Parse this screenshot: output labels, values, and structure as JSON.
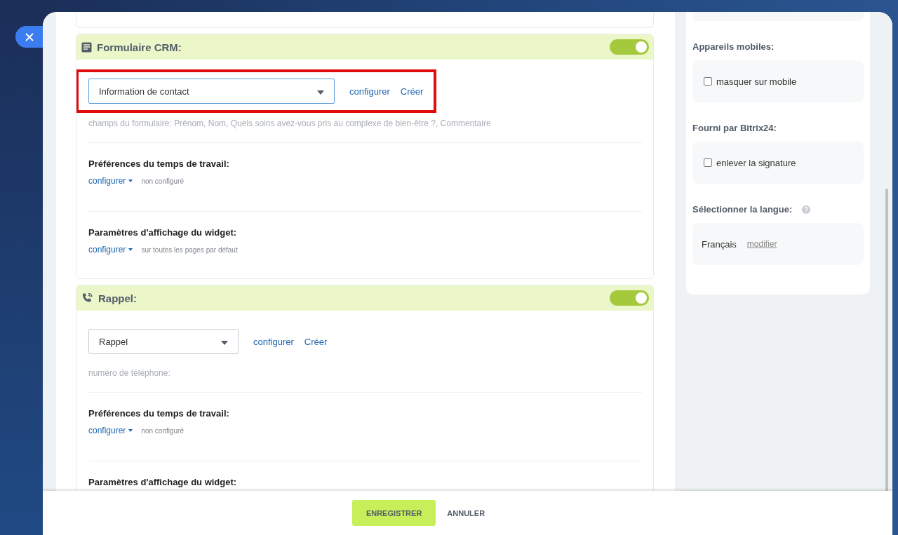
{
  "sections": [
    {
      "kind": "form",
      "title": "Formulaire CRM:",
      "enabled": true,
      "highlighted": true,
      "select": {
        "value": "Information de contact",
        "focused": true
      },
      "links": [
        "configurer",
        "Créer"
      ],
      "note": "champs du formulaire: Prénom, Nom, Quels soins avez-vous pris au complexe de bien-être ?, Commentaire",
      "settings": [
        {
          "title": "Préférences du temps de travail:",
          "link": "configurer",
          "value": "non configuré"
        },
        {
          "title": "Paramètres d'affichage du widget:",
          "link": "configurer",
          "value": "sur toutes les pages par défaut"
        }
      ]
    },
    {
      "kind": "callback",
      "title": "Rappel:",
      "enabled": true,
      "highlighted": false,
      "select": {
        "value": "Rappel",
        "focused": false
      },
      "links": [
        "configurer",
        "Créer"
      ],
      "note": "numéro de téléphone:",
      "settings": [
        {
          "title": "Préférences du temps de travail:",
          "link": "configurer",
          "value": "non configuré"
        },
        {
          "title": "Paramètres d'affichage du widget:"
        }
      ]
    }
  ],
  "sidebar": {
    "groups": [
      {
        "kind": "checkbox",
        "title": "Appareils mobiles:",
        "label": "masquer sur mobile",
        "checked": false
      },
      {
        "kind": "checkbox",
        "title": "Fourni par Bitrix24:",
        "label": "enlever la signature",
        "checked": false
      },
      {
        "kind": "language",
        "title": "Sélectionner la langue:",
        "help": true,
        "value": "Français",
        "link": "modifier"
      }
    ]
  },
  "footer": {
    "buttons": [
      {
        "kind": "primary",
        "label": "ENREGISTRER"
      },
      {
        "kind": "link",
        "label": "ANNULER"
      }
    ]
  }
}
